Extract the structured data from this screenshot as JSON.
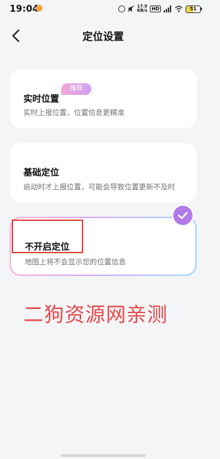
{
  "status_bar": {
    "time": "19:04",
    "network_speed_value": "17.9",
    "network_speed_unit": "KB/s",
    "network_type": "HD",
    "battery": "51",
    "colors": {
      "app_icon": "#f2a541",
      "battery_fill": "#f4d94a"
    }
  },
  "nav": {
    "title": "定位设置",
    "back_icon": "chevron-left-icon"
  },
  "options": [
    {
      "title": "实时位置",
      "badge": "推荐",
      "description": "实时上报位置，位置信息更精准",
      "selected": false
    },
    {
      "title": "基础定位",
      "description": "启动时才上报位置，可能会导致位置更新不及时",
      "selected": false
    },
    {
      "title": "不开启定位",
      "description": "地图上将不会显示您的位置信息",
      "selected": true
    }
  ],
  "selected_icon": "check-icon",
  "watermark": "二狗资源网亲测",
  "colors": {
    "accent": "#b07be8",
    "badge_gradient_start": "#f2a8d8",
    "badge_gradient_end": "#cfa2f4",
    "selected_border_start": "#f6b4da",
    "selected_border_end": "#a4d7ff",
    "annotation_red": "#e0453f",
    "watermark": "#e54848",
    "background": "#f4f5f7"
  }
}
